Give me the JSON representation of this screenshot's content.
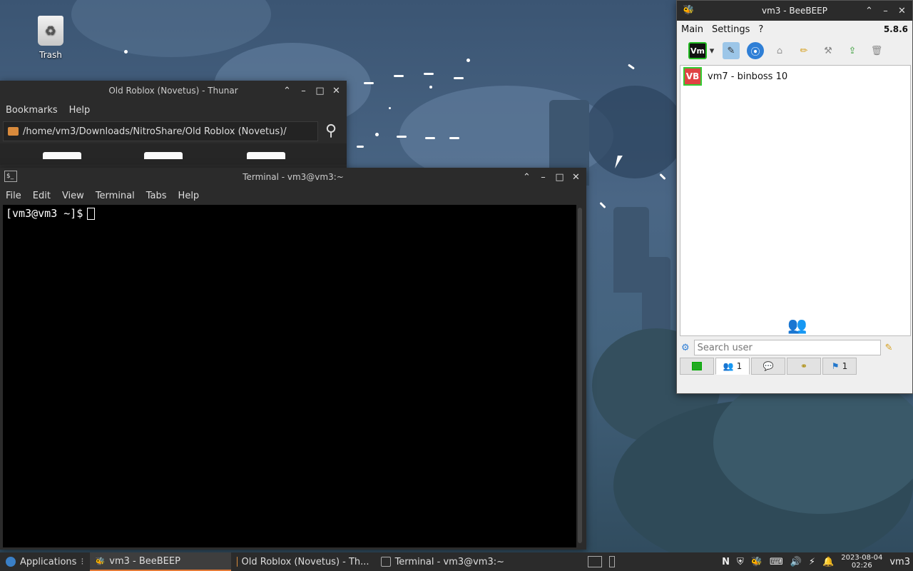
{
  "desktop": {
    "trash_label": "Trash"
  },
  "thunar": {
    "title": "Old Roblox (Novetus) - Thunar",
    "menu": [
      "Bookmarks",
      "Help"
    ],
    "path": "/home/vm3/Downloads/NitroShare/Old Roblox (Novetus)/"
  },
  "terminal": {
    "title": "Terminal - vm3@vm3:~",
    "menu": [
      "File",
      "Edit",
      "View",
      "Terminal",
      "Tabs",
      "Help"
    ],
    "prompt": "[vm3@vm3 ~]$"
  },
  "beebeep": {
    "title": "vm3 - BeeBEEP",
    "menu": [
      "Main",
      "Settings",
      "?"
    ],
    "version": "5.8.6",
    "toolbar_vm_label": "Vm",
    "users": [
      {
        "badge": "VB",
        "name": "vm7 - binboss 10"
      }
    ],
    "search_placeholder": "Search user",
    "tabs": [
      {
        "icon": "terminal-icon",
        "count": ""
      },
      {
        "icon": "users-icon",
        "count": "1"
      },
      {
        "icon": "chat-icon",
        "count": ""
      },
      {
        "icon": "groups-icon",
        "count": ""
      },
      {
        "icon": "files-icon",
        "count": "1"
      }
    ]
  },
  "taskbar": {
    "applications": "Applications",
    "tasks": [
      {
        "label": "vm3 - BeeBEEP",
        "active": true
      },
      {
        "label": "Old Roblox (Novetus) - Th...",
        "active": false
      },
      {
        "label": "Terminal - vm3@vm3:~",
        "active": false
      }
    ],
    "date": "2023-08-04",
    "time": "02:26",
    "user": "vm3"
  },
  "colors": {
    "accent": "#e47b37",
    "window_dark": "#2b2b2b",
    "badge_red": "#e04343"
  }
}
